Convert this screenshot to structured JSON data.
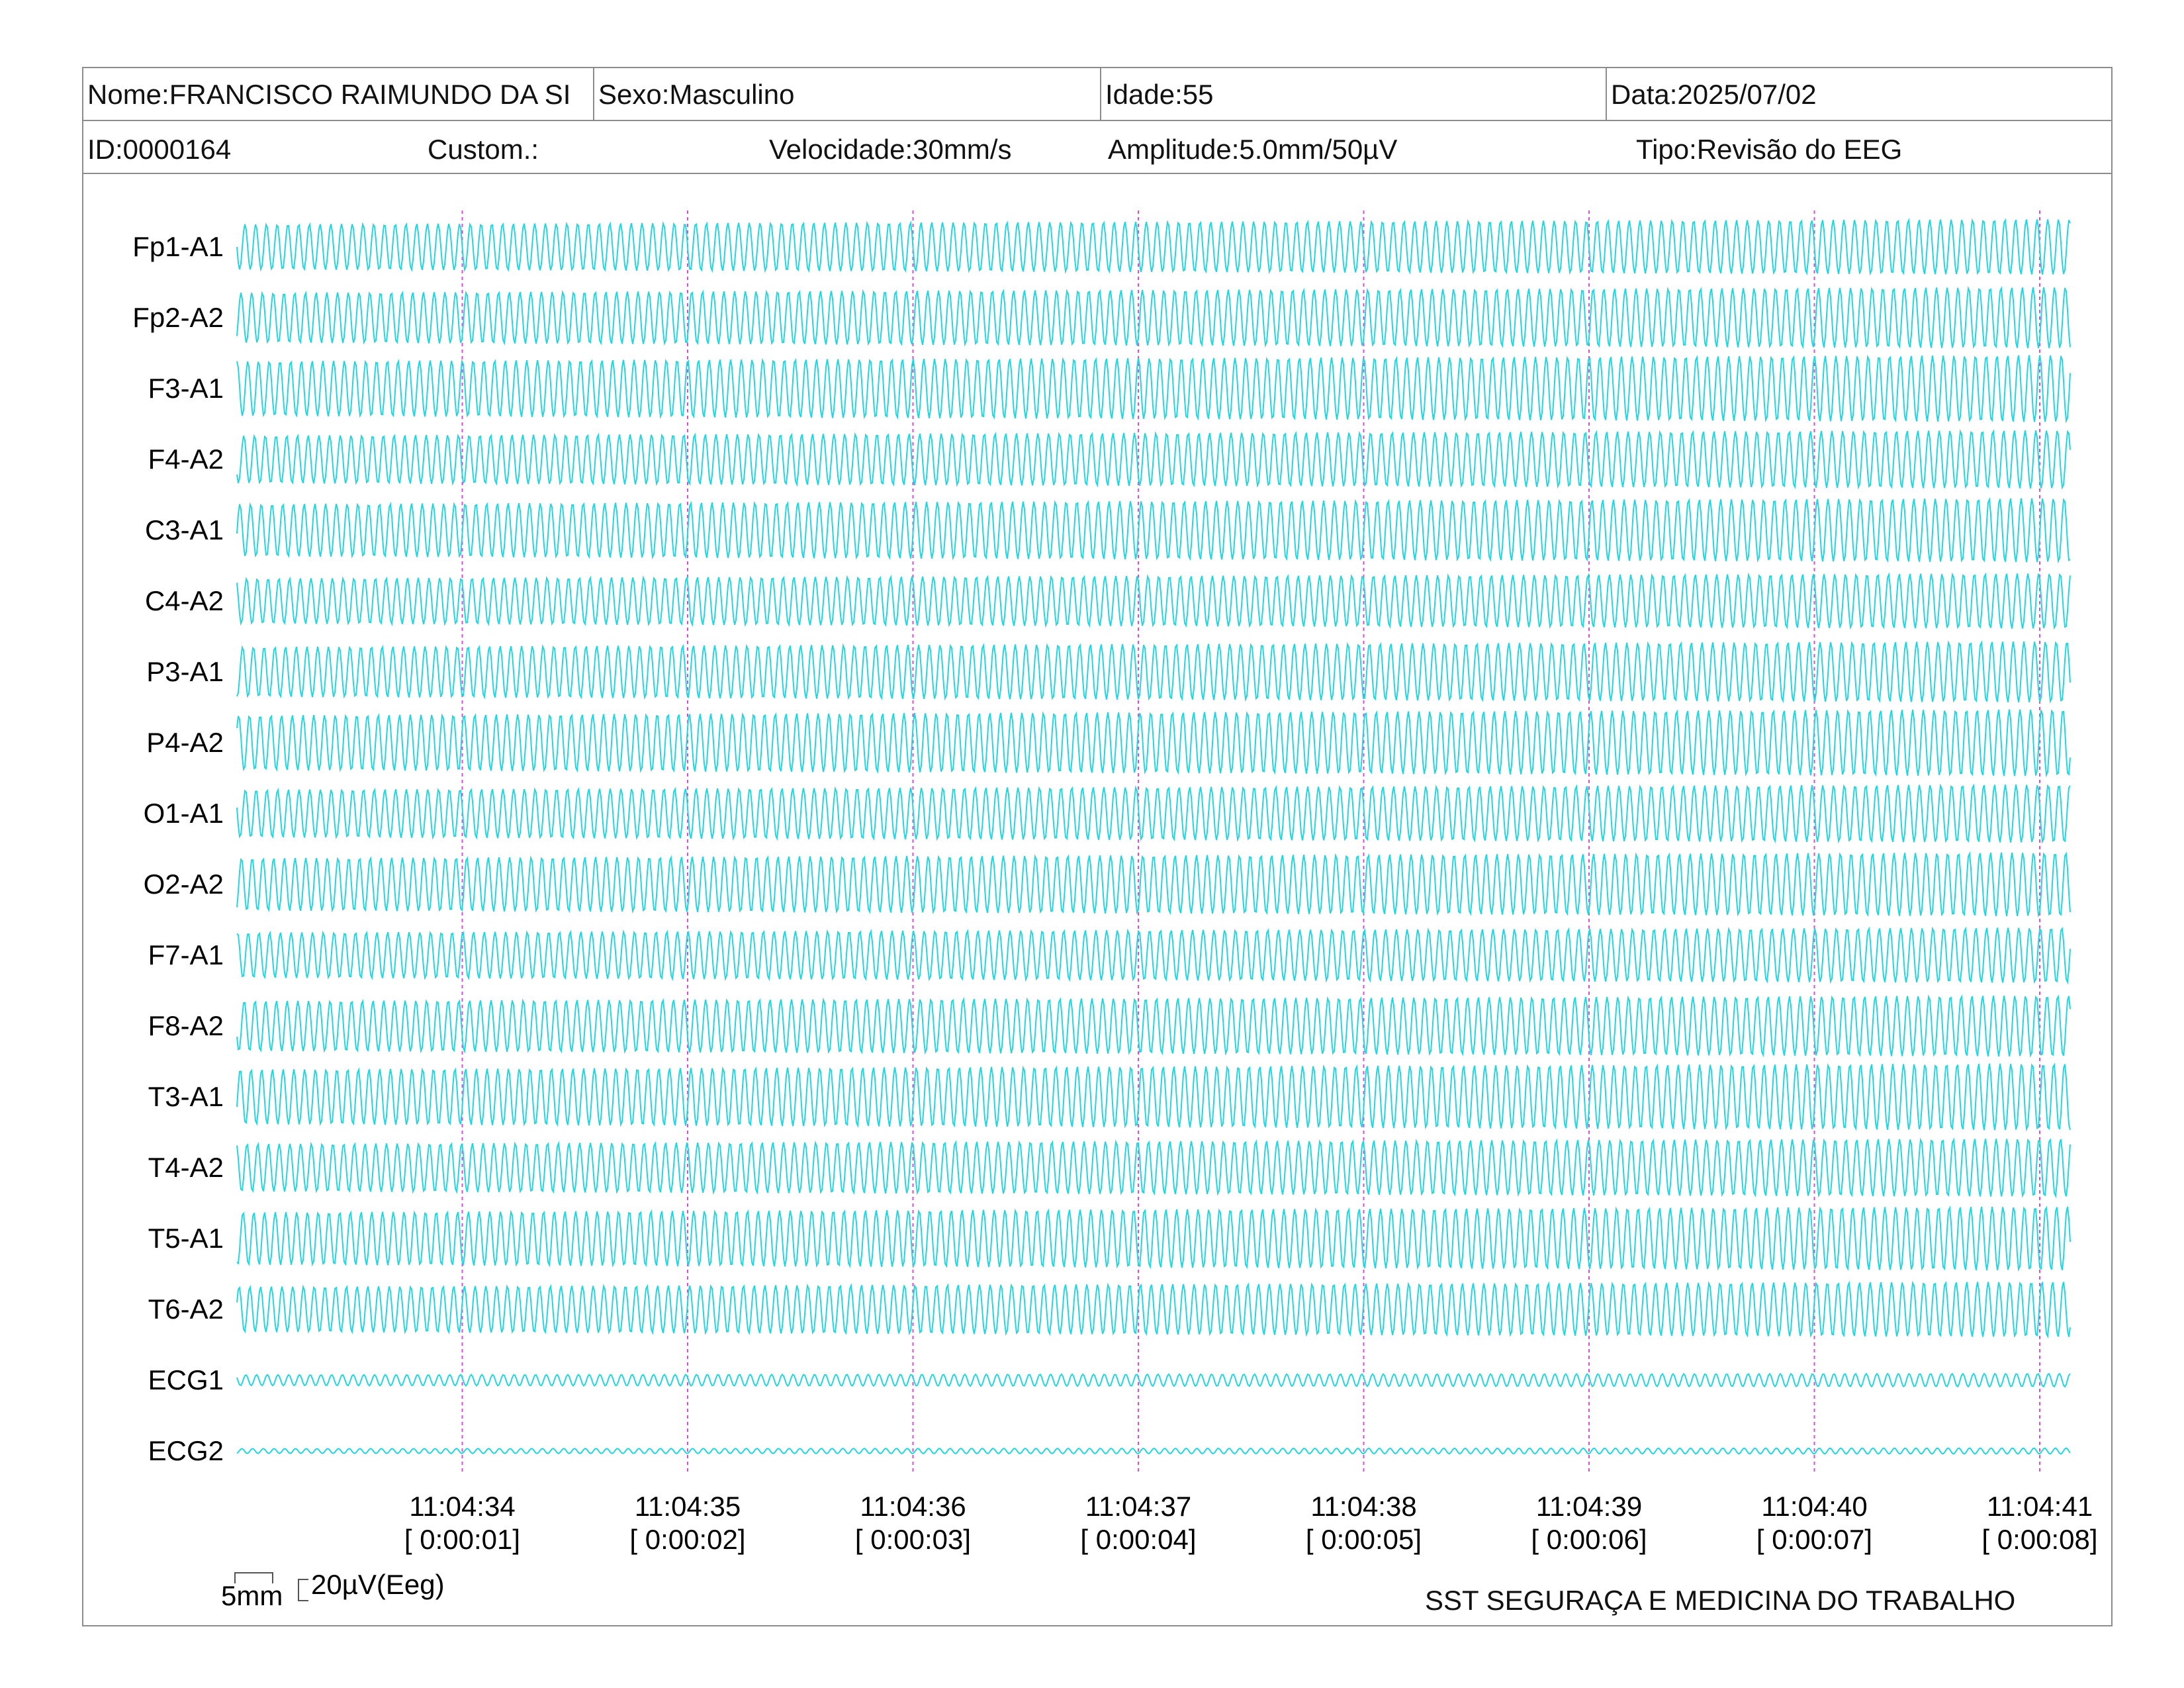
{
  "header": {
    "nome": "Nome:FRANCISCO RAIMUNDO DA SI",
    "sexo": "Sexo:Masculino",
    "idade": "Idade:55",
    "data": "Data:2025/07/02",
    "id": "ID:0000164",
    "custom": "Custom.:",
    "velocidade": "Velocidade:30mm/s",
    "amplitude": "Amplitude:5.0mm/50µV",
    "tipo": "Tipo:Revisão do EEG"
  },
  "colors": {
    "trace": "#22d6e0",
    "marker": "#d64fd6",
    "border": "#8c8c8c"
  },
  "chart_data": {
    "type": "line",
    "channels": [
      "Fp1-A1",
      "Fp2-A2",
      "F3-A1",
      "F4-A2",
      "C3-A1",
      "C4-A2",
      "P3-A1",
      "P4-A2",
      "O1-A1",
      "O2-A2",
      "F7-A1",
      "F8-A2",
      "T3-A1",
      "T4-A2",
      "T5-A1",
      "T6-A2",
      "ECG1",
      "ECG2"
    ],
    "time_markers": [
      {
        "time": "11:04:34",
        "elapsed": "[ 0:00:01]"
      },
      {
        "time": "11:04:35",
        "elapsed": "[ 0:00:02]"
      },
      {
        "time": "11:04:36",
        "elapsed": "[ 0:00:03]"
      },
      {
        "time": "11:04:37",
        "elapsed": "[ 0:00:04]"
      },
      {
        "time": "11:04:38",
        "elapsed": "[ 0:00:05]"
      },
      {
        "time": "11:04:39",
        "elapsed": "[ 0:00:06]"
      },
      {
        "time": "11:04:40",
        "elapsed": "[ 0:00:07]"
      },
      {
        "time": "11:04:41",
        "elapsed": "[ 0:00:08]"
      }
    ],
    "xlim_seconds": [
      0,
      8.14
    ],
    "cycles_per_second": 21,
    "speed_mm_per_s": 30,
    "amplitude_uV_per_5mm": 50,
    "grid": false
  },
  "scale_bar": {
    "time_label": "5mm",
    "amp_label": "20µV(Eeg)"
  },
  "footer": {
    "organization": "SST SEGURAÇA E MEDICINA DO TRABALHO"
  }
}
